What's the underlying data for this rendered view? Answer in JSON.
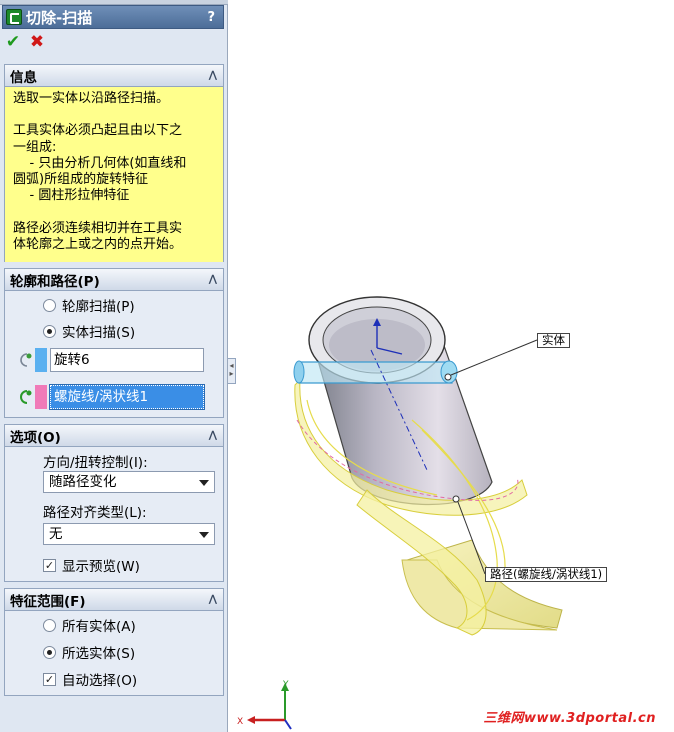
{
  "panel": {
    "title": "切除-扫描",
    "help": "?",
    "ok_icon": "✔",
    "cancel_icon": "✖"
  },
  "info": {
    "header": "信息",
    "text": "选取一实体以沿路径扫描。\n\n工具实体必须凸起且由以下之\n一组成:\n    - 只由分析几何体(如直线和\n圆弧)所组成的旋转特征\n    - 圆柱形拉伸特征\n\n路径必须连续相切并在工具实\n体轮廓之上或之内的点开始。"
  },
  "profile_path": {
    "header": "轮廓和路径(P)",
    "radio_profile": "轮廓扫描(P)",
    "radio_solid": "实体扫描(S)",
    "solid_value": "旋转6",
    "path_value": "螺旋线/涡状线1",
    "solid_swatch": "#5ab0f0",
    "path_swatch": "#f07ab8"
  },
  "options": {
    "header": "选项(O)",
    "orient_label": "方向/扭转控制(I):",
    "orient_value": "随路径变化",
    "align_label": "路径对齐类型(L):",
    "align_value": "无",
    "preview_label": "显示预览(W)"
  },
  "scope": {
    "header": "特征范围(F)",
    "all_bodies": "所有实体(A)",
    "selected_bodies": "所选实体(S)",
    "auto_select": "自动选择(O)"
  },
  "viewport": {
    "callout_solid": "实体",
    "callout_path": "路径(螺旋线/涡状线1)",
    "watermark": "三维网www.3dportal.cn",
    "axis_x": "X",
    "axis_y": "Y"
  },
  "colors": {
    "title_bar": "#4c6d98",
    "info_bg": "#ffff8c",
    "selection_blue": "#3a8ee6",
    "preview_yellow": "#f4f0a0"
  }
}
